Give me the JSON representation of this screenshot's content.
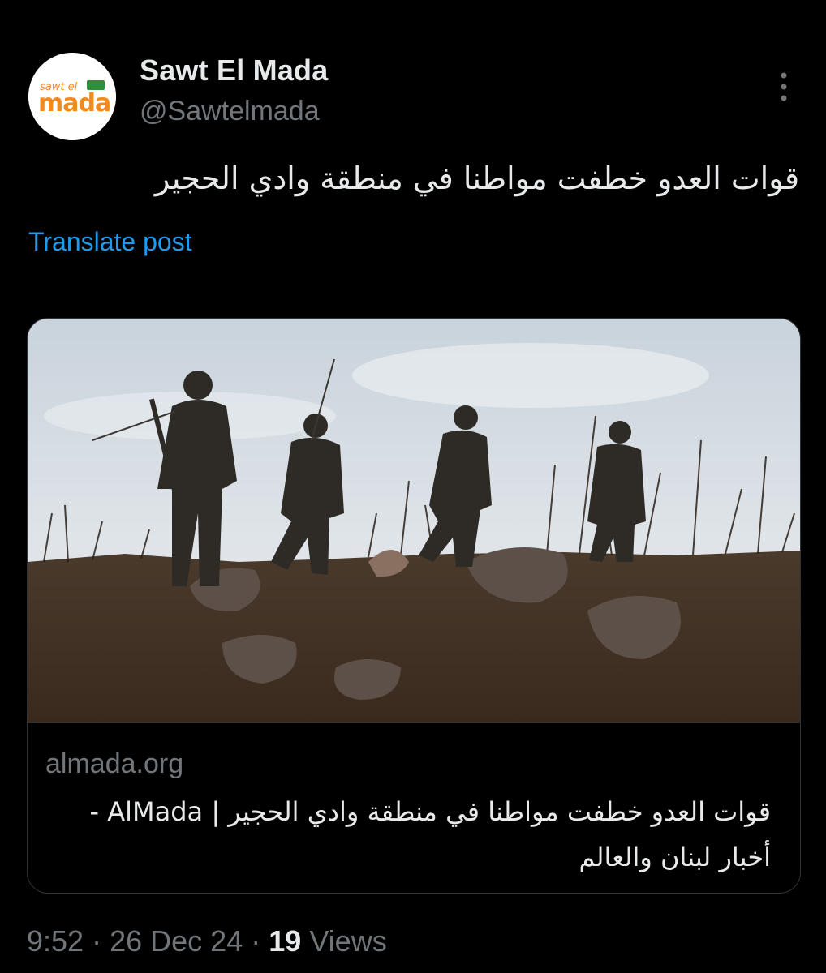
{
  "account": {
    "display_name": "Sawt El Mada",
    "handle": "@Sawtelmada",
    "avatar_logo_text": [
      "sawt el",
      "mada"
    ]
  },
  "post": {
    "text": "قوات العدو خطفت مواطنا في منطقة وادي الحجير",
    "translate_label": "Translate post"
  },
  "card": {
    "domain": "almada.org",
    "title": "قوات العدو خطفت مواطنا في منطقة وادي الحجير | AlMada - أخبار لبنان والعالم"
  },
  "meta": {
    "time": "9:52",
    "separator": "·",
    "date": "26 Dec 24",
    "views_count": "19",
    "views_label": "Views"
  },
  "icons": {
    "more": "more-vertical-icon"
  },
  "colors": {
    "background": "#000000",
    "primary_text": "#e7e9ea",
    "secondary_text": "#71767b",
    "link_blue": "#1d9bf0",
    "border": "#2f3336",
    "logo_orange": "#f28a1e",
    "logo_green": "#2f8f3a"
  }
}
